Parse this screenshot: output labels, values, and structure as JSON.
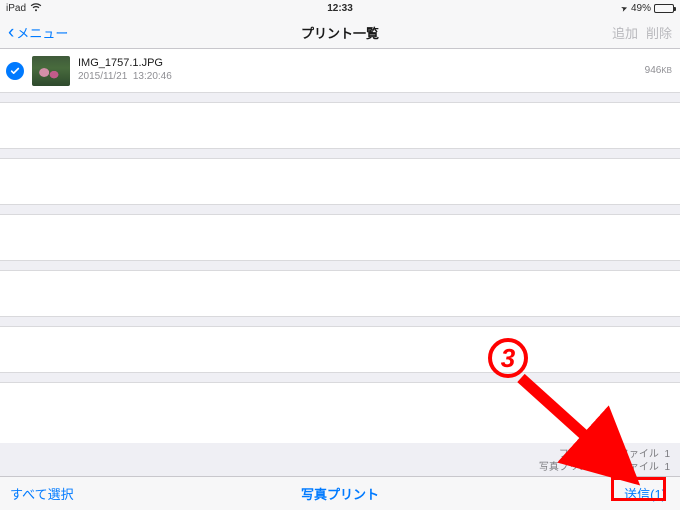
{
  "status": {
    "device": "iPad",
    "time": "12:33",
    "battery_pct": "49%",
    "location_glyph": "➤"
  },
  "nav": {
    "back_label": "メニュー",
    "title": "プリント一覧",
    "add_label": "追加",
    "delete_label": "削除"
  },
  "item": {
    "file_name": "IMG_1757.1.JPG",
    "date": "2015/11/21",
    "time": "13:20:46",
    "size_value": "946",
    "size_unit": "KB"
  },
  "info": {
    "line1_prefix": "フォルダー内ファイル",
    "line1_count": "1",
    "line2_prefix": "写真プリント可能ファイル",
    "line2_count": "1"
  },
  "toolbar": {
    "select_all": "すべて選択",
    "center": "写真プリント",
    "send": "送信(1)"
  },
  "annotation": {
    "badge": "3"
  }
}
